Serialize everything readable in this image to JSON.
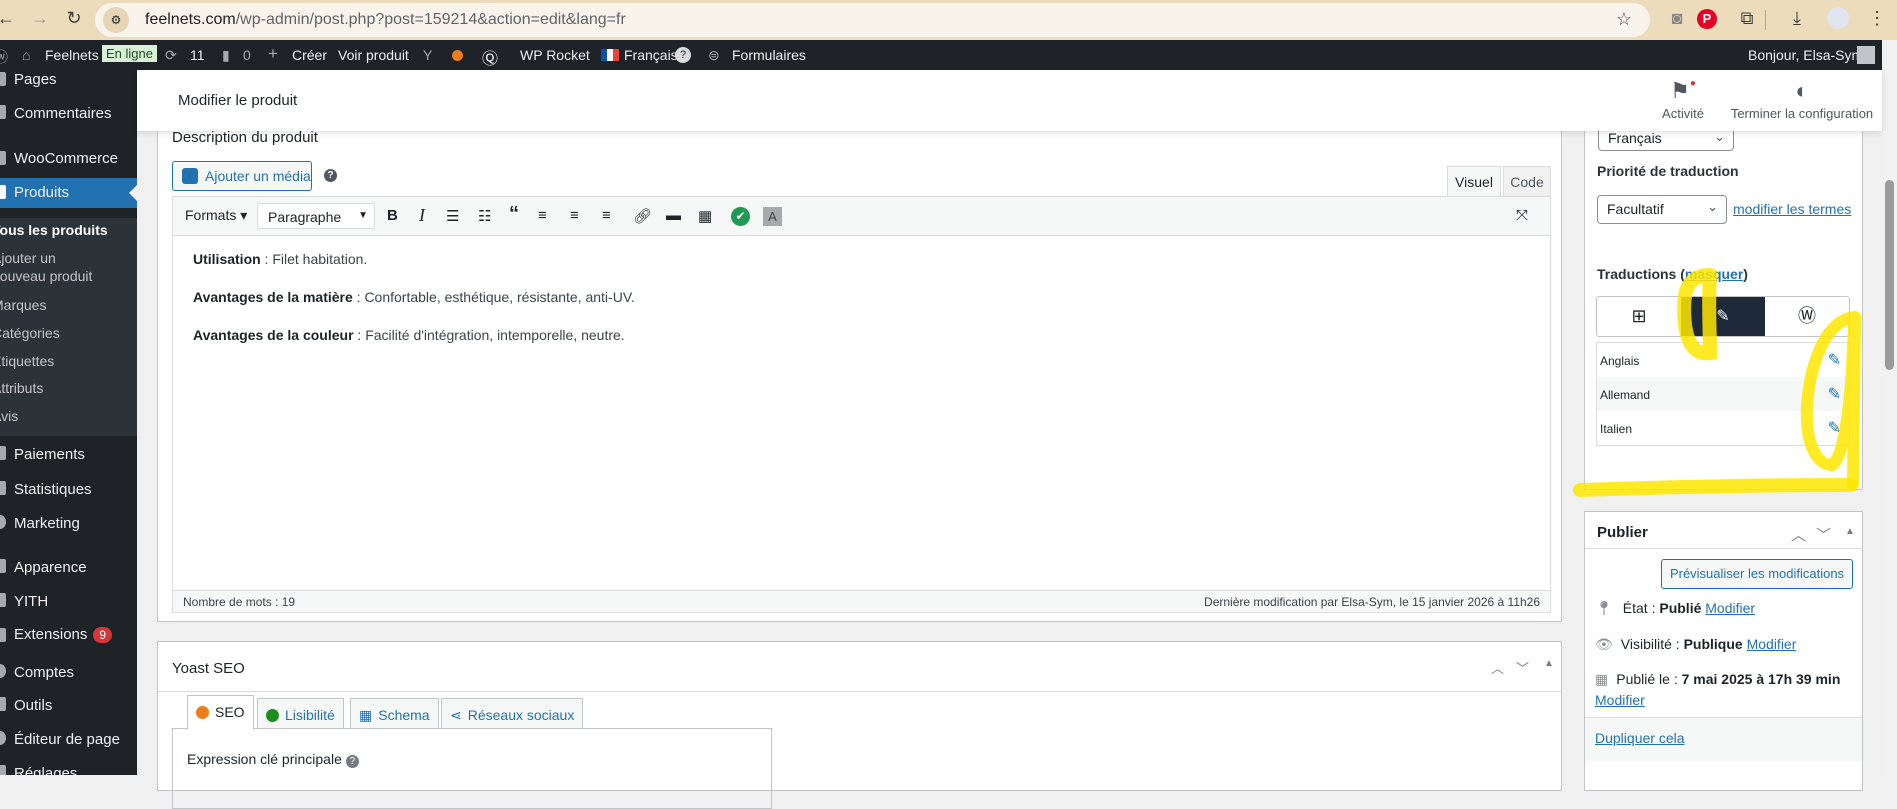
{
  "browser": {
    "url_host": "feelnets.com",
    "url_path": "/wp-admin/post.php?post=159214&action=edit&lang=fr",
    "icons": [
      "back-icon",
      "forward-icon",
      "reload-icon",
      "site-info-icon",
      "star-icon",
      "camera-icon",
      "pinterest-icon",
      "extensions-icon",
      "download-icon",
      "profile-icon",
      "menu-icon"
    ]
  },
  "adminbar": {
    "site": "Feelnets",
    "online": "En ligne",
    "updates": "11",
    "comments": "0",
    "create": "Créer",
    "view": "Voir produit",
    "rocket": "WP Rocket",
    "language": "Français",
    "help": "?",
    "forms": "Formulaires",
    "greeting": "Bonjour, Elsa-Sym"
  },
  "sidebar": {
    "items": [
      {
        "label": "Pages"
      },
      {
        "label": "Commentaires"
      },
      {
        "label": "WooCommerce"
      },
      {
        "label": "Produits"
      },
      {
        "label": "Paiements"
      },
      {
        "label": "Statistiques"
      },
      {
        "label": "Marketing"
      },
      {
        "label": "Apparence"
      },
      {
        "label": "YITH"
      },
      {
        "label": "Extensions",
        "count": "9"
      },
      {
        "label": "Comptes"
      },
      {
        "label": "Outils"
      },
      {
        "label": "Éditeur de page"
      },
      {
        "label": "Réglages"
      }
    ],
    "submenu": [
      "Tous les produits",
      "Ajouter un",
      "nouveau produit",
      "Marques",
      "Catégories",
      "Étiquettes",
      "Attributs",
      "Avis"
    ]
  },
  "header": {
    "title": "Modifier le produit",
    "activity": "Activité",
    "finish_setup": "Terminer la configuration"
  },
  "description": {
    "title": "Description du produit",
    "add_media": "Ajouter un média",
    "tab_visual": "Visuel",
    "tab_code": "Code",
    "formats": "Formats ▾",
    "paragraph": "Paragraphe",
    "content": [
      {
        "label": "Utilisation",
        "text": " : Filet habitation."
      },
      {
        "label": "Avantages de la matière",
        "text": " : Confortable, esthétique, résistante, anti-UV."
      },
      {
        "label": "Avantages de la couleur",
        "text": " : Facilité d'intégration, intemporelle, neutre."
      }
    ],
    "word_count": "Nombre de mots : 19",
    "last_modified": "Dernière modification par Elsa-Sym, le 15 janvier 2026 à 11h26"
  },
  "yoast": {
    "title": "Yoast SEO",
    "tabs": [
      "SEO",
      "Lisibilité",
      "Schema",
      "Réseaux sociaux"
    ],
    "keyphrase_label": "Expression clé principale"
  },
  "language_box": {
    "language": "Français",
    "priority_label": "Priorité de traduction",
    "priority": "Facultatif",
    "edit_terms": "modifier les termes",
    "translations_label": "Traductions",
    "hide": "masquer",
    "translations": [
      {
        "lang": "Anglais"
      },
      {
        "lang": "Allemand"
      },
      {
        "lang": "Italien"
      }
    ]
  },
  "publish": {
    "title": "Publier",
    "preview": "Prévisualiser les modifications",
    "state_label": "État : ",
    "state": "Publié",
    "visibility_label": "Visibilité : ",
    "visibility": "Publique",
    "published_label": "Publié le : ",
    "published": "7 mai 2025 à 17h 39 min",
    "modify": "Modifier",
    "duplicate": "Dupliquer cela"
  },
  "colors": {
    "accent": "#2271b1",
    "adminbar": "#1d2327",
    "highlight": "#ffe600"
  }
}
